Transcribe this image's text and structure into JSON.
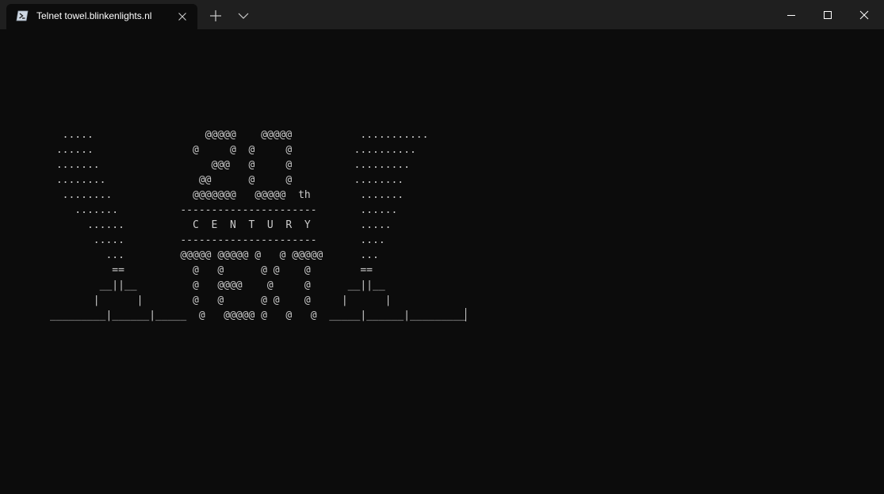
{
  "tab": {
    "title": "Telnet towel.blinkenlights.nl"
  },
  "terminal": {
    "lines": [
      "  .....                  @@@@@    @@@@@           ...........",
      " ......                @     @  @     @          ..........",
      " .......                  @@@   @     @          .........",
      " ........               @@      @     @          ........",
      "  ........             @@@@@@@   @@@@@  th        .......",
      "    .......          ----------------------       ......",
      "      ......           C  E  N  T  U  R  Y        .....",
      "       .....         ----------------------       ....",
      "         ...         @@@@@ @@@@@ @   @ @@@@@      ...",
      "          ==           @   @      @ @    @        ==",
      "        __||__         @   @@@@    @     @      __||__",
      "       |      |        @   @      @ @    @     |      |",
      "_________|______|_____  @   @@@@@ @   @   @  _____|______|_________"
    ]
  }
}
